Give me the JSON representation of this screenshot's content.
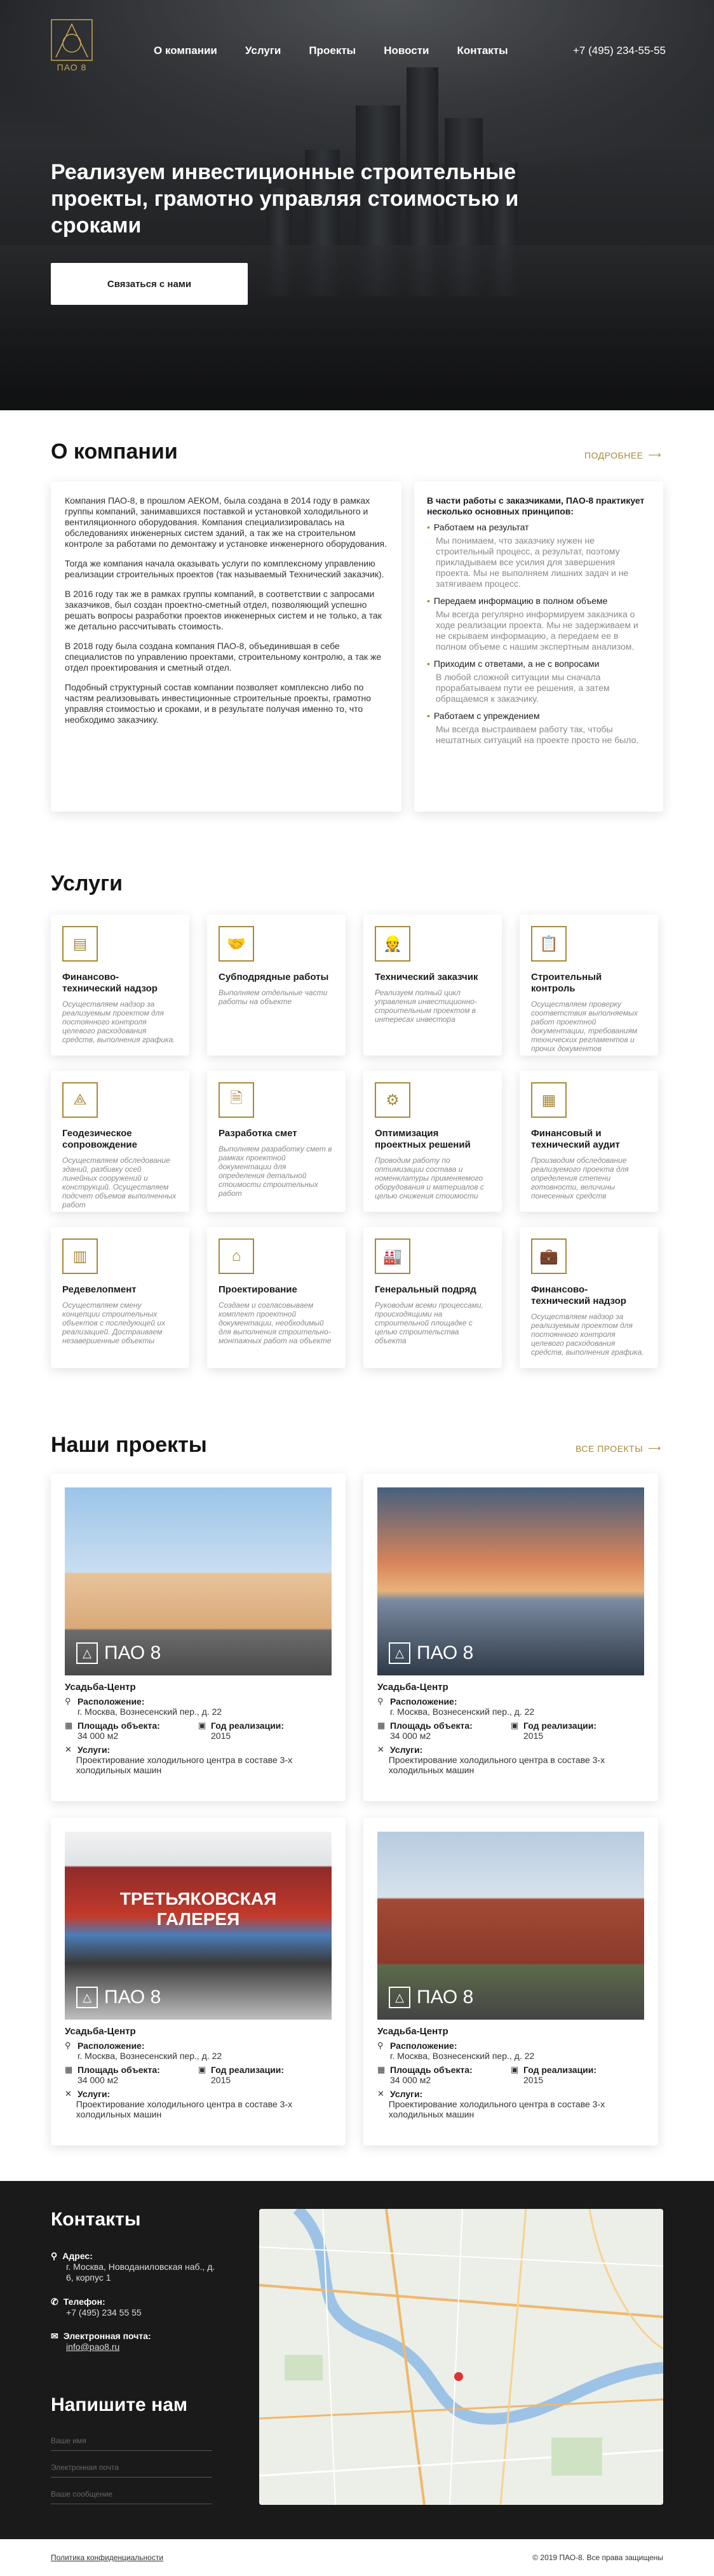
{
  "header": {
    "logo_text": "ПАО 8",
    "nav": [
      "О компании",
      "Услуги",
      "Проекты",
      "Новости",
      "Контакты"
    ],
    "phone": "+7 (495) 234-55-55"
  },
  "hero": {
    "title": "Реализуем инвестиционные строительные проекты, грамотно управляя стоимостью и сроками",
    "cta": "Связаться с нами"
  },
  "about": {
    "title": "О компании",
    "more": "ПОДРОБНЕЕ",
    "paragraphs": [
      "Компания ПАО-8, в прошлом АЕКОМ, была создана в 2014 году в рамках группы компаний, занимавшихся поставкой и установкой холодильного и вентиляционного оборудования. Компания специализировалась на обследованиях инженерных систем зданий, а так же на строительном контроле за работами по демонтажу и установке инженерного оборудования.",
      "Тогда же компания начала оказывать услуги по комплексному управлению реализации строительных проектов (так называемый Технический заказчик).",
      "В 2016 году так же в рамках группы компаний, в соответствии с запросами заказчиков, был создан проектно-сметный отдел, позволяющий успешно решать вопросы разработки проектов инженерных систем и не только, а так же детально рассчитывать стоимость.",
      "В 2018 году была создана компания ПАО-8, объединившая в себе специалистов по управлению проектами, строительному контролю, а так же отдел проектирования и сметный отдел.",
      "Подобный структурный состав компании позволяет комплексно либо по частям реализовывать инвестиционные строительные проекты, грамотно управляя стоимостью и сроками, и в результате получая именно то, что необходимо заказчику."
    ],
    "principles_intro": "В части работы с заказчиками, ПАО-8 практикует несколько основных принципов:",
    "principles": [
      {
        "title": "Работаем на результат",
        "text": "Мы понимаем, что заказчику нужен не строительный процесс, а результат, поэтому прикладываем все усилия для завершения проекта. Мы не выполняем лишних задач и не затягиваем процесс."
      },
      {
        "title": "Передаем информацию в полном объеме",
        "text": "Мы всегда регулярно информируем заказчика о ходе реализации проекта. Мы не задерживаем и не скрываем информацию, а передаем ее в полном объеме с нашим экспертным анализом."
      },
      {
        "title": "Приходим с ответами, а не с вопросами",
        "text": "В любой сложной ситуации мы сначала прорабатываем пути ее решения, а затем обращаемся к заказчику."
      },
      {
        "title": "Работаем с упреждением",
        "text": "Мы всегда выстраиваем работу так, чтобы нештатных ситуаций на проекте просто не было."
      }
    ]
  },
  "services": {
    "title": "Услуги",
    "items": [
      {
        "icon": "document-icon",
        "title": "Финансово-технический надзор",
        "text": "Осуществляем надзор за реализуемым проектом для постоянного контроля целевого расходования средств, выполнения графика."
      },
      {
        "icon": "handshake-icon",
        "title": "Субподрядные работы",
        "text": "Выполняем отдельные части работы на объекте"
      },
      {
        "icon": "engineer-icon",
        "title": "Технический заказчик",
        "text": "Реализуем полный цикл управления инвестиционно-строительным проектом в интересах инвестора"
      },
      {
        "icon": "clipboard-icon",
        "title": "Строительный контроль",
        "text": "Осуществляем проверку соответствия выполняемых работ проектной документации, требованиям технических регламентов и прочих документов"
      },
      {
        "icon": "compass-icon",
        "title": "Геодезическое сопровождение",
        "text": "Осуществляем обследование зданий, разбивку осей линейных сооружений и конструкций. Осуществляем подсчет объемов выполненных работ"
      },
      {
        "icon": "estimate-icon",
        "title": "Разработка смет",
        "text": "Выполняем разработку смет в рамках проектной документации для определения детальной стоимости строительных работ"
      },
      {
        "icon": "gears-icon",
        "title": "Оптимизация проектных решений",
        "text": "Проводим работу по оптимизации состава и номенклатуры применяемого оборудования и материалов с целью снижения стоимости"
      },
      {
        "icon": "calculator-icon",
        "title": "Финансовый и технический аудит",
        "text": "Производим обследование реализуемого проекта для определения степени готовности, величины понесенных средств"
      },
      {
        "icon": "building-icon",
        "title": "Редевелопмент",
        "text": "Осуществляем смену концепции строительных объектов с последующей их реализацией. Достраиваем незавершенные объекты"
      },
      {
        "icon": "blueprint-icon",
        "title": "Проектирование",
        "text": "Создаем и согласовываем комплект проектной документации, необходимый для выполнения строительно-монтажных работ на объекте"
      },
      {
        "icon": "factory-icon",
        "title": "Генеральный подряд",
        "text": "Руководим всеми процессами, происходящими на строительной площадке с целью строительства объекта"
      },
      {
        "icon": "briefcase-icon",
        "title": "Финансово-технический надзор",
        "text": "Осуществляем надзор за реализуемым проектом для постоянного контроля целевого расходования средств, выполнения графика."
      }
    ]
  },
  "projects": {
    "title": "Наши проекты",
    "more": "ВСЕ ПРОЕКТЫ",
    "watermark": "ПАО 8",
    "labels": {
      "location": "Расположение:",
      "area": "Площадь объекта:",
      "year": "Год реализации:",
      "services": "Услуги:"
    },
    "items": [
      {
        "name": "Усадьба-Центр",
        "location": "г. Москва, Вознесенский пер., д. 22",
        "area": "34 000 м2",
        "year": "2015",
        "services": "Проектирование холодильного центра в составе 3-х холодильных машин"
      },
      {
        "name": "Усадьба-Центр",
        "location": "г. Москва, Вознесенский пер., д. 22",
        "area": "34 000 м2",
        "year": "2015",
        "services": "Проектирование холодильного центра в составе 3-х холодильных машин"
      },
      {
        "name": "Усадьба-Центр",
        "location": "г. Москва, Вознесенский пер., д. 22",
        "area": "34 000 м2",
        "year": "2015",
        "services": "Проектирование холодильного центра в составе 3-х холодильных машин",
        "banner": "ТРЕТЬЯКОВСКАЯ ГАЛЕРЕЯ"
      },
      {
        "name": "Усадьба-Центр",
        "location": "г. Москва, Вознесенский пер., д. 22",
        "area": "34 000 м2",
        "year": "2015",
        "services": "Проектирование холодильного центра в составе 3-х холодильных машин"
      }
    ]
  },
  "contacts": {
    "title": "Контакты",
    "address_label": "Адрес:",
    "address": "г. Москва, Новоданиловская наб., д. 6, корпус 1",
    "phone_label": "Телефон:",
    "phone": "+7 (495) 234 55 55",
    "email_label": "Электронная почта:",
    "email": "info@pao8.ru",
    "write_title": "Напишите нам",
    "fields": [
      "Ваше имя",
      "Электронная почта",
      "Ваше сообщение"
    ]
  },
  "footer": {
    "privacy": "Политика конфиденциальности",
    "copyright": "© 2019 ПАО-8. Все права защищены"
  },
  "colors": {
    "accent": "#a8893a",
    "dark": "#1a1a1a"
  }
}
